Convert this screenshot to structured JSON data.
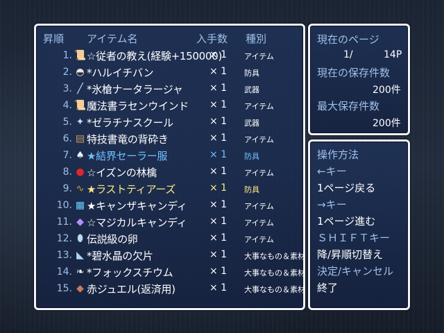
{
  "main": {
    "headers": {
      "rank": "昇順",
      "item": "アイテム名",
      "qty": "入手数",
      "cat": "種別"
    },
    "rows": [
      {
        "rank": "1.",
        "icon": "scroll-ribbon-icon",
        "name": "☆従者の教え(経験+150000)",
        "qty": "× 1",
        "cat": "アイテム",
        "style": ""
      },
      {
        "rank": "2.",
        "icon": "hat-icon",
        "name": "*ハルイチバン",
        "qty": "× 1",
        "cat": "防具",
        "style": ""
      },
      {
        "rank": "3.",
        "icon": "spear-icon",
        "name": "*氷槍ナータラージャ",
        "qty": "× 1",
        "cat": "武器",
        "style": ""
      },
      {
        "rank": "4.",
        "icon": "scroll-icon",
        "name": "魔法書ラセンウインド",
        "qty": "× 1",
        "cat": "アイテム",
        "style": ""
      },
      {
        "rank": "5.",
        "icon": "wand-icon",
        "name": "*ゼラチナスクール",
        "qty": "× 1",
        "cat": "武器",
        "style": ""
      },
      {
        "rank": "6.",
        "icon": "book-icon",
        "name": "特技書竜の背砕き",
        "qty": "× 1",
        "cat": "アイテム",
        "style": ""
      },
      {
        "rank": "7.",
        "icon": "sailor-suit-icon",
        "name": "★結界セーラー服",
        "qty": "× 1",
        "cat": "防具",
        "style": "blue"
      },
      {
        "rank": "8.",
        "icon": "apple-icon",
        "name": "☆イズンの林檎",
        "qty": "× 1",
        "cat": "アイテム",
        "style": ""
      },
      {
        "rank": "9.",
        "icon": "necklace-icon",
        "name": "★ラストティアーズ",
        "qty": "× 1",
        "cat": "防具",
        "style": "yellow"
      },
      {
        "rank": "10.",
        "icon": "candy-box-icon",
        "name": "★キャンザキャンディ",
        "qty": "× 1",
        "cat": "アイテム",
        "style": ""
      },
      {
        "rank": "11.",
        "icon": "candy-icon",
        "name": "☆マジカルキャンディ",
        "qty": "× 1",
        "cat": "アイテム",
        "style": ""
      },
      {
        "rank": "12.",
        "icon": "egg-icon",
        "name": "伝説級の卵",
        "qty": "× 1",
        "cat": "アイテム",
        "style": ""
      },
      {
        "rank": "13.",
        "icon": "crystal-shard-icon",
        "name": "*碧水晶の欠片",
        "qty": "× 1",
        "cat": "大事なもの＆素材",
        "style": ""
      },
      {
        "rank": "14.",
        "icon": "feather-icon",
        "name": "*フォックスチウム",
        "qty": "× 1",
        "cat": "大事なもの＆素材",
        "style": ""
      },
      {
        "rank": "15.",
        "icon": "jewel-icon",
        "name": "赤ジュエル(返済用)",
        "qty": "× 1",
        "cat": "大事なもの＆素材",
        "style": ""
      }
    ]
  },
  "page_panel": {
    "current_page_label": "現在のページ",
    "current_page": "1/",
    "total_pages": "14P",
    "saved_label": "現在の保存件数",
    "saved_count": "200件",
    "max_label": "最大保存件数",
    "max_count": "200件"
  },
  "help_panel": {
    "title": "操作方法",
    "items": [
      "←キー",
      "1ページ戻る",
      "→キー",
      "1ページ進む",
      "ＳＨＩＦＴキー",
      "降/昇順切替え",
      "決定/キャンセル",
      "終了"
    ]
  },
  "colors": {
    "header_text": "#9fc0ea",
    "highlight_blue": "#6fc3ff",
    "highlight_yellow": "#ffe98a",
    "window_border": "#f2f4f8"
  }
}
